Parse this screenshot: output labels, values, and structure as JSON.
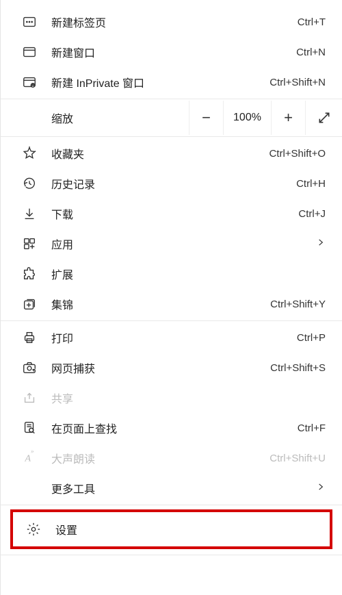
{
  "menu": {
    "newTab": {
      "label": "新建标签页",
      "shortcut": "Ctrl+T"
    },
    "newWindow": {
      "label": "新建窗口",
      "shortcut": "Ctrl+N"
    },
    "newInPrivate": {
      "label": "新建 InPrivate 窗口",
      "shortcut": "Ctrl+Shift+N"
    },
    "zoom": {
      "label": "缩放",
      "value": "100%"
    },
    "favorites": {
      "label": "收藏夹",
      "shortcut": "Ctrl+Shift+O"
    },
    "history": {
      "label": "历史记录",
      "shortcut": "Ctrl+H"
    },
    "downloads": {
      "label": "下载",
      "shortcut": "Ctrl+J"
    },
    "apps": {
      "label": "应用"
    },
    "extensions": {
      "label": "扩展"
    },
    "collections": {
      "label": "集锦",
      "shortcut": "Ctrl+Shift+Y"
    },
    "print": {
      "label": "打印",
      "shortcut": "Ctrl+P"
    },
    "webCapture": {
      "label": "网页捕获",
      "shortcut": "Ctrl+Shift+S"
    },
    "share": {
      "label": "共享"
    },
    "findOnPage": {
      "label": "在页面上查找",
      "shortcut": "Ctrl+F"
    },
    "readAloud": {
      "label": "大声朗读",
      "shortcut": "Ctrl+Shift+U"
    },
    "moreTools": {
      "label": "更多工具"
    },
    "settings": {
      "label": "设置"
    }
  }
}
